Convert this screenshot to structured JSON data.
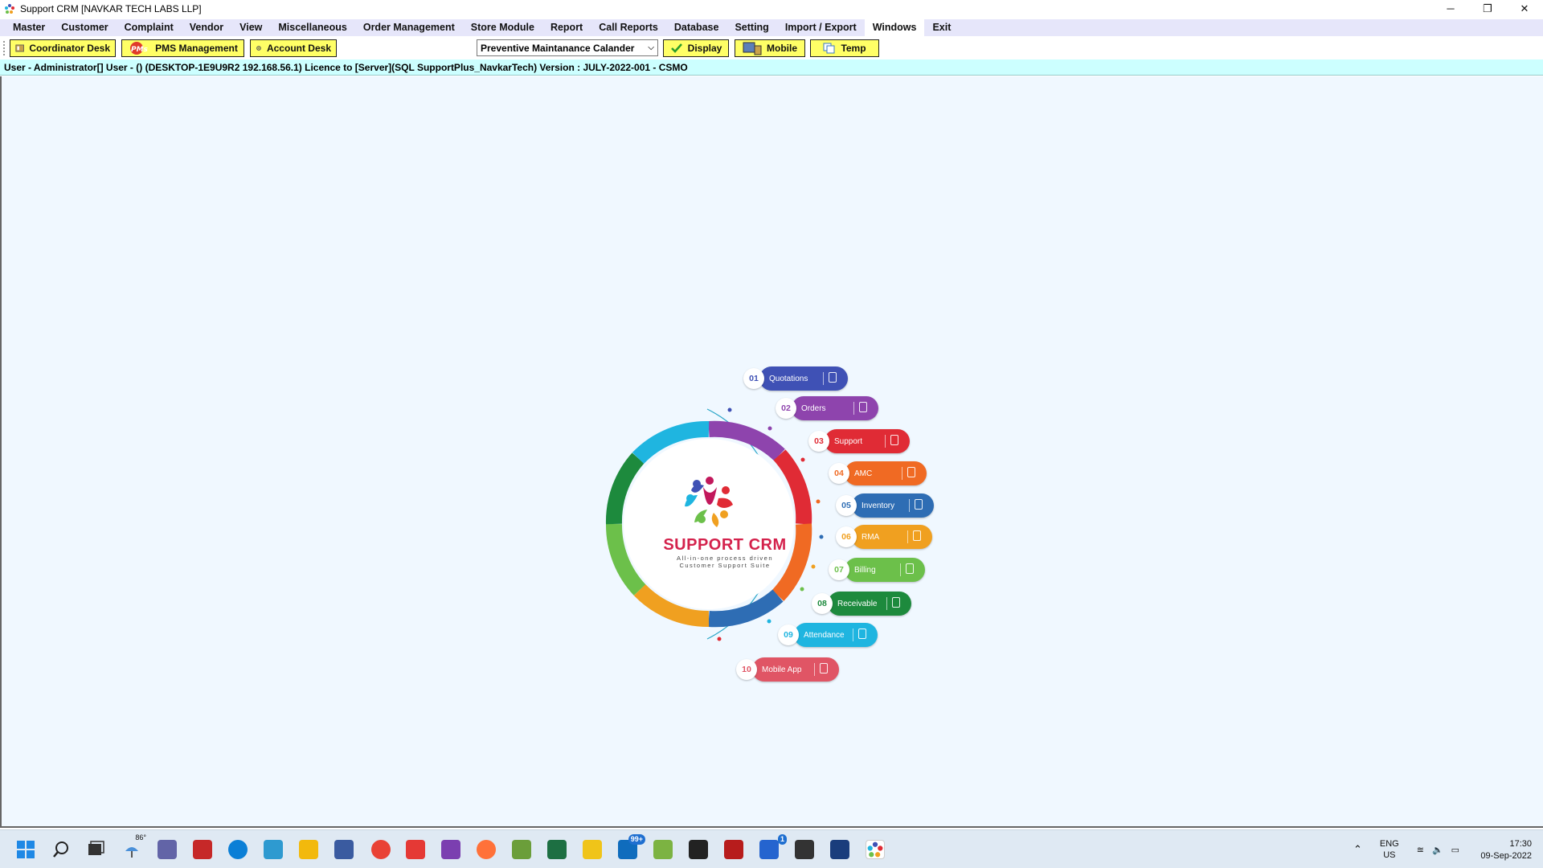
{
  "window": {
    "title": "Support CRM [NAVKAR TECH LABS LLP]",
    "controls": {
      "minimize": "─",
      "restore": "❐",
      "close": "✕"
    }
  },
  "menu": {
    "items": [
      "Master",
      "Customer",
      "Complaint",
      "Vendor",
      "View",
      "Miscellaneous",
      "Order Management",
      "Store Module",
      "Report",
      "Call Reports",
      "Database",
      "Setting",
      "Import / Export",
      "Windows",
      "Exit"
    ],
    "active": "Windows"
  },
  "toolbar": {
    "coordinator_desk": "Coordinator Desk",
    "pms_management": "PMS Management",
    "account_desk": "Account Desk",
    "calendar_select": "Preventive Maintanance Calander",
    "display": "Display",
    "mobile": "Mobile",
    "temp": "Temp"
  },
  "status": {
    "text": "User - Administrator[] User - () (DESKTOP-1E9U9R2 192.168.56.1)  Licence to  [Server](SQL SupportPlus_NavkarTech)  Version : JULY-2022-001 - CSMO"
  },
  "diagram": {
    "logo_title": "SUPPORT CRM",
    "logo_sub1": "All-in-one process driven",
    "logo_sub2": "Customer Support Suite",
    "modules": [
      {
        "num": "01",
        "label": "Quotations",
        "color": "#3f51b5",
        "icon": "document-icon"
      },
      {
        "num": "02",
        "label": "Orders",
        "color": "#8e44ad",
        "icon": "order-icon"
      },
      {
        "num": "03",
        "label": "Support",
        "color": "#e02b35",
        "icon": "support-icon"
      },
      {
        "num": "04",
        "label": "AMC",
        "color": "#f06a23",
        "icon": "contract-icon"
      },
      {
        "num": "05",
        "label": "Inventory",
        "color": "#2e6db4",
        "icon": "inventory-icon"
      },
      {
        "num": "06",
        "label": "RMA",
        "color": "#f0a020",
        "icon": "rma-icon"
      },
      {
        "num": "07",
        "label": "Billing",
        "color": "#6cc04a",
        "icon": "billing-icon"
      },
      {
        "num": "08",
        "label": "Receivable",
        "color": "#1d8a3d",
        "icon": "receivable-icon"
      },
      {
        "num": "09",
        "label": "Attendance",
        "color": "#1fb5e0",
        "icon": "attendance-icon"
      },
      {
        "num": "10",
        "label": "Mobile App",
        "color": "#e05565",
        "icon": "mobile-app-icon"
      }
    ]
  },
  "taskbar": {
    "weather_temp": "86°",
    "mail_badge": "99+",
    "todo_badge": "1",
    "lang_line1": "ENG",
    "lang_line2": "US",
    "time": "17:30",
    "date": "09-Sep-2022"
  }
}
